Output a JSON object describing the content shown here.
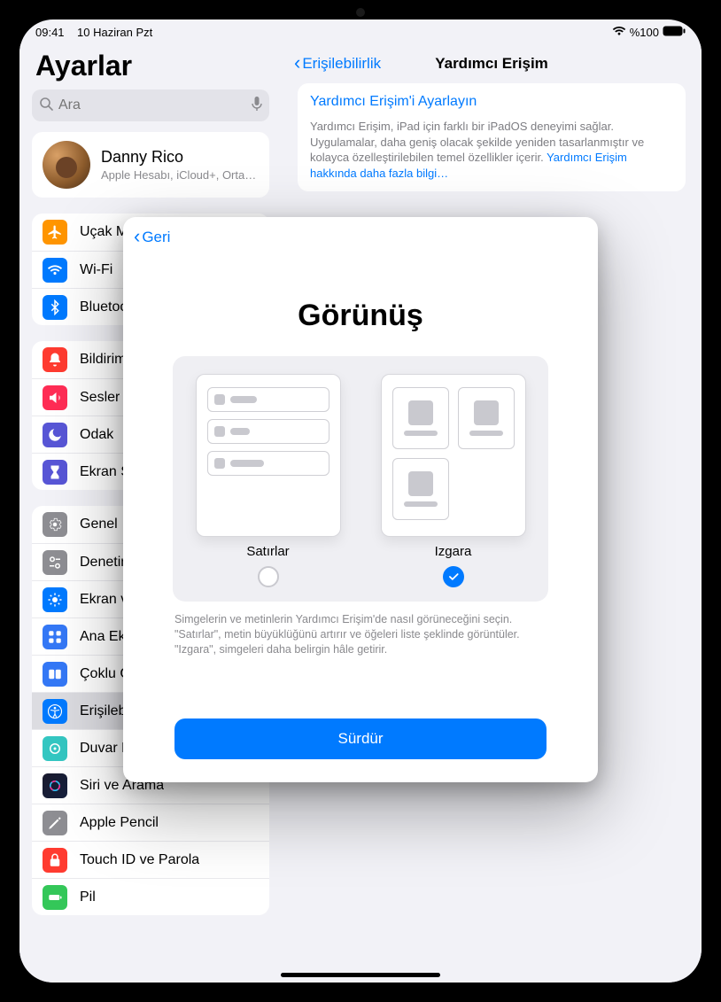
{
  "status": {
    "time": "09:41",
    "date": "10 Haziran Pzt",
    "battery": "%100"
  },
  "sidebar": {
    "title": "Ayarlar",
    "search_placeholder": "Ara",
    "account": {
      "name": "Danny Rico",
      "sub": "Apple Hesabı, iCloud+, Ortamlar"
    },
    "groups": [
      {
        "items": [
          {
            "label": "Uçak Modu",
            "icon": "airplane",
            "color": "#ff9500"
          },
          {
            "label": "Wi-Fi",
            "icon": "wifi",
            "color": "#007aff"
          },
          {
            "label": "Bluetooth",
            "icon": "bluetooth",
            "color": "#007aff"
          }
        ]
      },
      {
        "items": [
          {
            "label": "Bildirimler",
            "icon": "bell",
            "color": "#ff3b30"
          },
          {
            "label": "Sesler",
            "icon": "speaker",
            "color": "#ff2d55"
          },
          {
            "label": "Odak",
            "icon": "moon",
            "color": "#5856d6"
          },
          {
            "label": "Ekran Süresi",
            "icon": "hourglass",
            "color": "#5856d6"
          }
        ]
      },
      {
        "items": [
          {
            "label": "Genel",
            "icon": "gear",
            "color": "#8e8e93"
          },
          {
            "label": "Denetim Merkezi",
            "icon": "switches",
            "color": "#8e8e93"
          },
          {
            "label": "Ekran ve Parlaklık",
            "icon": "brightness",
            "color": "#007aff"
          },
          {
            "label": "Ana Ekran ve Uygulama Arşivi",
            "icon": "grid",
            "color": "#3478f6"
          },
          {
            "label": "Çoklu Görev ve Hareketler",
            "icon": "multitask",
            "color": "#3478f6"
          },
          {
            "label": "Erişilebilirlik",
            "icon": "accessibility",
            "color": "#007aff",
            "active": true
          },
          {
            "label": "Duvar Kâğıdı",
            "icon": "wallpaper",
            "color": "#34c7c2"
          },
          {
            "label": "Siri ve Arama",
            "icon": "siri",
            "color": "#303030"
          },
          {
            "label": "Apple Pencil",
            "icon": "pencil",
            "color": "#8e8e93"
          },
          {
            "label": "Touch ID ve Parola",
            "icon": "touchid",
            "color": "#ff3b30"
          },
          {
            "label": "Pil",
            "icon": "battery",
            "color": "#34c759"
          }
        ]
      }
    ]
  },
  "main": {
    "back_label": "Erişilebilirlik",
    "title": "Yardımcı Erişim",
    "setup_link": "Yardımcı Erişim'i Ayarlayın",
    "description": "Yardımcı Erişim, iPad için farklı bir iPadOS deneyimi sağlar. Uygulamalar, daha geniş olacak şekilde yeniden tasarlanmıştır ve kolayca özelleştirilebilen temel özellikler içerir. ",
    "more_link": "Yardımcı Erişim hakkında daha fazla bilgi…"
  },
  "modal": {
    "back_label": "Geri",
    "title": "Görünüş",
    "options": {
      "rows": {
        "label": "Satırlar",
        "selected": false
      },
      "grid": {
        "label": "Izgara",
        "selected": true
      }
    },
    "description": "Simgelerin ve metinlerin Yardımcı Erişim'de nasıl görüneceğini seçin. \"Satırlar\", metin büyüklüğünü artırır ve öğeleri liste şeklinde görüntüler. \"Izgara\", simgeleri daha belirgin hâle getirir.",
    "continue_label": "Sürdür"
  }
}
